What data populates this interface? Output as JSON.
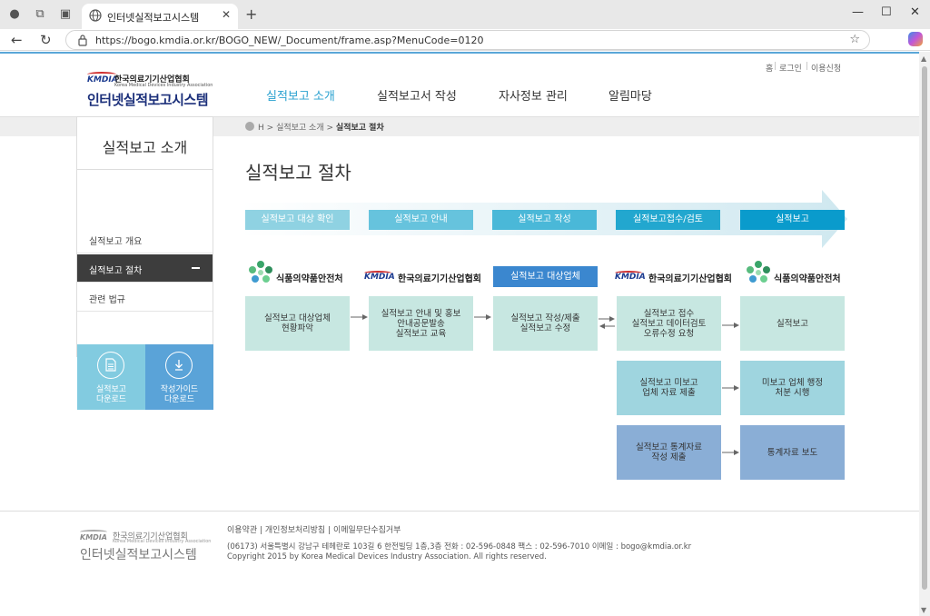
{
  "browser": {
    "tab_title": "인터넷실적보고시스템",
    "url": "https://bogo.kmdia.or.kr/BOGO_NEW/_Document/frame.asp?MenuCode=0120",
    "new_tab": "+",
    "close": "✕",
    "window_controls": [
      "—",
      "☐",
      "✕"
    ]
  },
  "header": {
    "util_links": [
      "홈",
      "로그인",
      "이용신청"
    ],
    "logo": {
      "brand": "KMDIA",
      "org_name": "한국의료기기산업협회",
      "org_name_en": "Korea Medical Devices Industry Association",
      "system_name": "인터넷실적보고시스템"
    },
    "gnb": [
      "실적보고 소개",
      "실적보고서 작성",
      "자사정보 관리",
      "알림마당"
    ],
    "gnb_active": 0
  },
  "sidebar": {
    "heading": "실적보고 소개",
    "items": [
      {
        "label": "실적보고 개요"
      },
      {
        "label": "실적보고 절차"
      },
      {
        "label": "관련 법규"
      }
    ],
    "active_index": 1,
    "downloads": [
      {
        "label": "실적보고\n다운로드",
        "icon": "document-icon",
        "color": "#82cbe0"
      },
      {
        "label": "작성가이드\n다운로드",
        "icon": "guide-icon",
        "color": "#5aa3d8"
      }
    ]
  },
  "breadcrumb": {
    "home": "H",
    "parent": "실적보고 소개",
    "current": "실적보고 절차",
    "sep": ">"
  },
  "page_title": "실적보고 절차",
  "process": {
    "steps": [
      {
        "label": "실적보고 대상 확인",
        "color": "#8fd2e2"
      },
      {
        "label": "실적보고 안내",
        "color": "#66c3dd"
      },
      {
        "label": "실적보고 작성",
        "color": "#4ab8d8"
      },
      {
        "label": "실적보고접수/검토",
        "color": "#22a7cf"
      },
      {
        "label": "실적보고",
        "color": "#0a9bcc"
      }
    ],
    "arrow_color": "#e4f2f6"
  },
  "orgs": {
    "mfds": "식품의약품안전처",
    "kmdia": "한국의료기기산업협회",
    "kmdia_brand": "KMDIA",
    "target_companies": "실적보고 대상업체"
  },
  "boxes": {
    "col1": "실적보고 대상업체\n현황파악",
    "col2": "실적보고 안내 및 홍보\n안내공문발송\n실적보고 교육",
    "col3": "실적보고 작성/제출\n실적보고 수정",
    "col4_row1": "실적보고 접수\n실적보고 데이터검토\n오류수정 요청",
    "col5_row1": "실적보고",
    "col4_row2": "실적보고 미보고\n업체 자료 제출",
    "col5_row2": "미보고 업체 행정\n처분 시행",
    "col4_row3": "실적보고 통계자료\n작성 제출",
    "col5_row3": "통계자료 보도"
  },
  "footer": {
    "links": [
      "이용약관",
      "개인정보처리방침",
      "이메일무단수집거부"
    ],
    "address": "(06173) 서울특별시 강남구 테헤란로 103길 6 한전빌딩 1층,3층 전화 : 02-596-0848 팩스 : 02-596-7010 이메일 : bogo@kmdia.or.kr",
    "copyright": "Copyright 2015 by Korea Medical Devices Industry Association. All rights reserved.",
    "logo": {
      "brand": "KMDIA",
      "org_name": "한국의료기기산업협회",
      "org_name_en": "Korea Medical Devices Industry Association",
      "system_name": "인터넷실적보고시스템"
    }
  }
}
